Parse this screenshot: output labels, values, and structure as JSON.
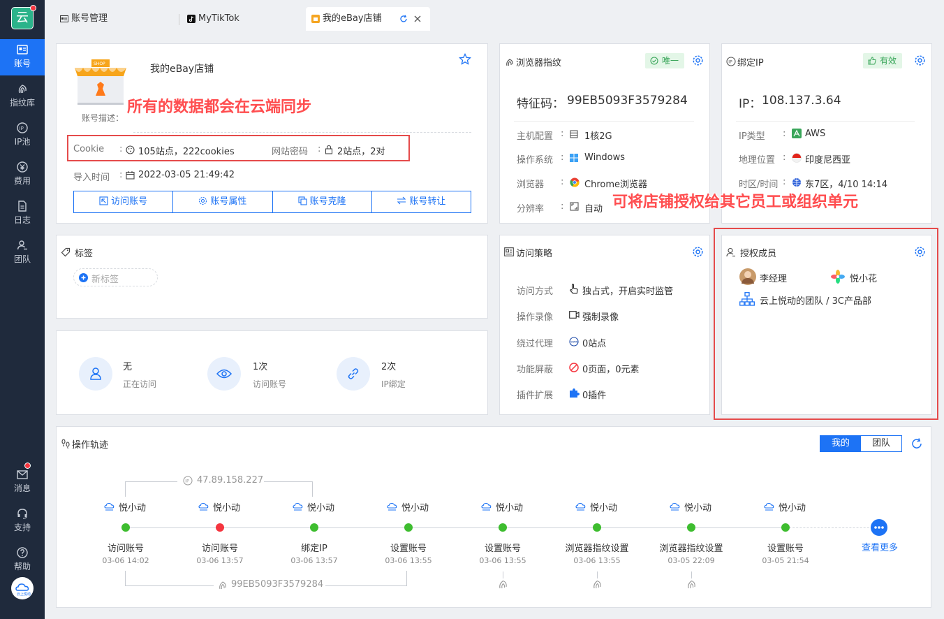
{
  "sidebar": {
    "logo_text": "云",
    "items": [
      {
        "label": "账号",
        "icon": "id-card-icon"
      },
      {
        "label": "指纹库",
        "icon": "fingerprint-icon"
      },
      {
        "label": "IP池",
        "icon": "ip-icon"
      },
      {
        "label": "费用",
        "icon": "yen-icon"
      },
      {
        "label": "日志",
        "icon": "log-icon"
      },
      {
        "label": "团队",
        "icon": "team-icon"
      }
    ],
    "bottom": [
      {
        "label": "消息",
        "icon": "mail-icon"
      },
      {
        "label": "支持",
        "icon": "headset-icon"
      },
      {
        "label": "帮助",
        "icon": "help-icon"
      }
    ]
  },
  "tabs": [
    {
      "label": "账号管理"
    },
    {
      "label": "MyTikTok"
    },
    {
      "label": "我的eBay店铺"
    }
  ],
  "account": {
    "shop_sign": "SHOP",
    "name": "我的eBay店铺",
    "desc_label": "账号描述：",
    "cookie_label": "Cookie",
    "cookie_value": "105站点，222cookies",
    "pwd_label": "网站密码",
    "pwd_value": "2站点，2对",
    "import_label": "导入时间",
    "import_value": "2022-03-05 21:49:42",
    "buttons": [
      "访问账号",
      "账号属性",
      "账号克隆",
      "账号转让"
    ]
  },
  "annotations": {
    "cloud_sync": "所有的数据都会在云端同步",
    "authorize": "可将店铺授权给其它员工或组织单元"
  },
  "fingerprint": {
    "title": "浏览器指纹",
    "badge": "唯一",
    "code_label": "特征码：",
    "code": "99EB5093F3579284",
    "rows": [
      {
        "label": "主机配置",
        "value": "1核2G"
      },
      {
        "label": "操作系统",
        "value": "Windows"
      },
      {
        "label": "浏览器",
        "value": "Chrome浏览器"
      },
      {
        "label": "分辨率",
        "value": "自动"
      }
    ]
  },
  "ip": {
    "title": "绑定IP",
    "badge": "有效",
    "ip_label": "IP：",
    "ip": "108.137.3.64",
    "rows": [
      {
        "label": "IP类型",
        "value": "AWS"
      },
      {
        "label": "地理位置",
        "value": "印度尼西亚"
      },
      {
        "label": "时区/时间",
        "value": "东7区，4/10 14:14"
      }
    ]
  },
  "tags": {
    "title": "标签",
    "new_tag": "新标签"
  },
  "stats": [
    {
      "value": "无",
      "label": "正在访问"
    },
    {
      "value": "1次",
      "label": "访问账号"
    },
    {
      "value": "2次",
      "label": "IP绑定"
    }
  ],
  "policy": {
    "title": "访问策略",
    "rows": [
      {
        "label": "访问方式",
        "value": "独占式，开启实时监管"
      },
      {
        "label": "操作录像",
        "value": "强制录像"
      },
      {
        "label": "绕过代理",
        "value": "0站点"
      },
      {
        "label": "功能屏蔽",
        "value": "0页面，0元素"
      },
      {
        "label": "插件扩展",
        "value": "0插件"
      }
    ]
  },
  "members": {
    "title": "授权成员",
    "people": [
      "李经理",
      "悦小花"
    ],
    "org": "云上悦动的团队 / 3C产品部"
  },
  "timeline": {
    "title": "操作轨迹",
    "seg_mine": "我的",
    "seg_team": "团队",
    "ip_note": "47.89.158.227",
    "fp_note": "99EB5093F3579284",
    "logo_small": "云上悦动",
    "more": "查看更多",
    "events": [
      {
        "user": "悦小动",
        "action": "访问账号",
        "time": "03-06 14:02",
        "status": "ok"
      },
      {
        "user": "悦小动",
        "action": "访问账号",
        "time": "03-06 13:57",
        "status": "error"
      },
      {
        "user": "悦小动",
        "action": "绑定IP",
        "time": "03-06 13:57",
        "status": "ok"
      },
      {
        "user": "悦小动",
        "action": "设置账号",
        "time": "03-06 13:55",
        "status": "ok"
      },
      {
        "user": "悦小动",
        "action": "设置账号",
        "time": "03-06 13:55",
        "status": "ok"
      },
      {
        "user": "悦小动",
        "action": "浏览器指纹设置",
        "time": "03-06 13:55",
        "status": "ok"
      },
      {
        "user": "悦小动",
        "action": "浏览器指纹设置",
        "time": "03-05 22:09",
        "status": "ok"
      },
      {
        "user": "悦小动",
        "action": "设置账号",
        "time": "03-05 21:54",
        "status": "ok"
      }
    ]
  },
  "colors": {
    "primary": "#1d73f5",
    "success": "#3ebd2f",
    "danger": "#f5353f",
    "sidebar": "#1f2a3c"
  }
}
